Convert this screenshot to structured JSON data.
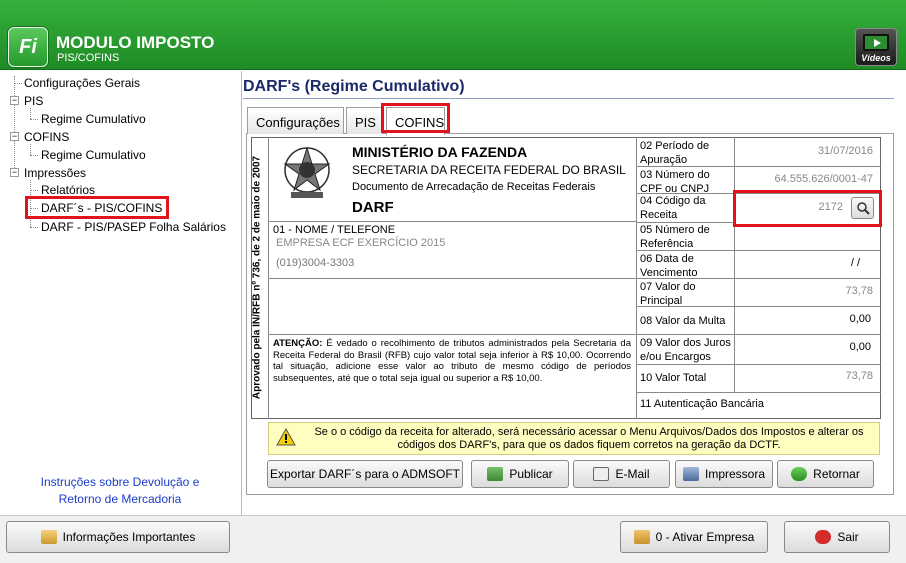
{
  "app": {
    "title": "MODULO IMPOSTO",
    "subtitle": "PIS/COFINS",
    "logo": "Fi",
    "videos_label": "Vídeos"
  },
  "tree": {
    "items": [
      "Configurações Gerais",
      "PIS",
      "Regime Cumulativo",
      "COFINS",
      "Regime Cumulativo",
      "Impressões",
      "Relatórios",
      "DARF´s - PIS/COFINS",
      "DARF - PIS/PASEP Folha Salários"
    ],
    "selected": "DARF´s - PIS/COFINS"
  },
  "instructions": "Instruções sobre Devolução e Retorno de Mercadoria",
  "page_title": "DARF's (Regime Cumulativo)",
  "tabs": [
    "Configurações",
    "PIS",
    "COFINS"
  ],
  "active_tab": "COFINS",
  "darf": {
    "vertical_text": "Aprovado pela IN/RFB nº 736, de 2 de maio de 2007",
    "ministry": "MINISTÉRIO DA FAZENDA",
    "secretaria": "SECRETARIA DA RECEITA FEDERAL DO BRASIL",
    "documento": "Documento de Arrecadação de Receitas Federais",
    "darf": "DARF",
    "nome_label": "01 - NOME / TELEFONE",
    "empresa": "EMPRESA ECF EXERCÍCIO 2015",
    "telefone": "(019)3004-3303",
    "atencao_label": "ATENÇÃO:",
    "atencao_text": "É vedado o recolhimento de tributos administrados pela Secretaria da Receita Federal do Brasil (RFB) cujo valor total seja inferior à R$ 10,00. Ocorrendo tal situação, adicione esse valor ao tributo de mesmo código de períodos subsequentes, até que o total seja igual ou superior a R$ 10,00.",
    "fields": [
      {
        "label": "02 Período de Apuração",
        "value": "31/07/2016"
      },
      {
        "label": "03 Número do CPF ou CNPJ",
        "value": "64.555.626/0001-47"
      },
      {
        "label": "04 Código da Receita",
        "value": "2172"
      },
      {
        "label": "05 Número de Referência",
        "value": ""
      },
      {
        "label": "06 Data de Vencimento",
        "value": "/ /"
      },
      {
        "label": "07 Valor do Principal",
        "value": "73,78"
      },
      {
        "label": "08 Valor da Multa",
        "value": "0,00"
      },
      {
        "label": "09 Valor dos Juros e/ou Encargos",
        "value": "0,00"
      },
      {
        "label": "10 Valor Total",
        "value": "73,78"
      },
      {
        "label": "11 Autenticação Bancária",
        "value": ""
      }
    ]
  },
  "warning": "Se o o código da receita for alterado, será necessário acessar o Menu Arquivos/Dados dos Impostos e alterar os códigos dos DARF's, para que os dados fiquem corretos na geração da DCTF.",
  "buttons": {
    "exportar": "Exportar DARF´s para o ADMSOFT",
    "publicar": "Publicar",
    "email": "E-Mail",
    "impressora": "Impressora",
    "retornar": "Retornar",
    "info": "Informações Importantes",
    "ativar": "0 - Ativar Empresa",
    "sair": "Sair"
  },
  "colors": {
    "header_green": "#2aa230",
    "highlight_red": "#e1141b",
    "link_blue": "#1a3cc8",
    "title_navy": "#1a2a6a"
  }
}
